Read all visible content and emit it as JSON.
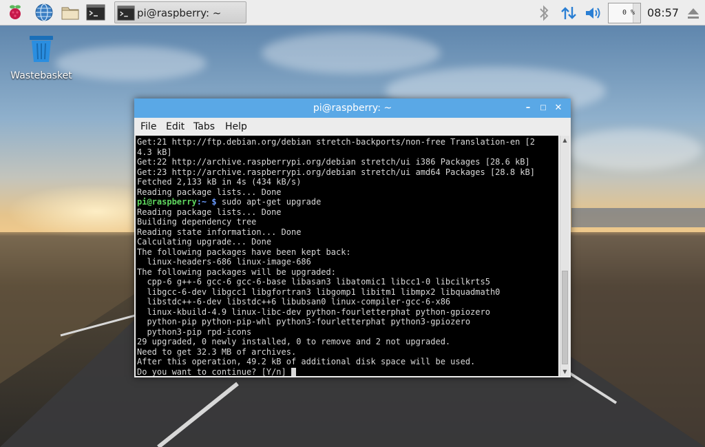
{
  "panel": {
    "icons": [
      "raspberry-menu-icon",
      "web-browser-icon",
      "file-manager-icon",
      "terminal-icon"
    ],
    "task": {
      "label": "pi@raspberry: ~"
    },
    "tray": [
      "bluetooth-icon",
      "network-transfer-icon",
      "volume-icon"
    ],
    "cpu_usage": "0 %",
    "clock": "08:57",
    "eject_icon": "eject-icon"
  },
  "desktop": {
    "icons": [
      {
        "label": "Wastebasket",
        "icon": "wastebasket-icon"
      }
    ]
  },
  "terminal": {
    "title": "pi@raspberry: ~",
    "menu": [
      "File",
      "Edit",
      "Tabs",
      "Help"
    ],
    "lines": [
      "Get:21 http://ftp.debian.org/debian stretch-backports/non-free Translation-en [2",
      "4.3 kB]",
      "Get:22 http://archive.raspberrypi.org/debian stretch/ui i386 Packages [28.6 kB]",
      "Get:23 http://archive.raspberrypi.org/debian stretch/ui amd64 Packages [28.8 kB]",
      "Fetched 2,133 kB in 4s (434 kB/s)",
      "Reading package lists... Done"
    ],
    "prompt": {
      "user": "pi@raspberry",
      "path": ":~ $",
      "command": " sudo apt-get upgrade"
    },
    "output": [
      "Reading package lists... Done",
      "Building dependency tree",
      "Reading state information... Done",
      "Calculating upgrade... Done",
      "The following packages have been kept back:",
      "  linux-headers-686 linux-image-686",
      "The following packages will be upgraded:",
      "  cpp-6 g++-6 gcc-6 gcc-6-base libasan3 libatomic1 libcc1-0 libcilkrts5",
      "  libgcc-6-dev libgcc1 libgfortran3 libgomp1 libitm1 libmpx2 libquadmath0",
      "  libstdc++-6-dev libstdc++6 libubsan0 linux-compiler-gcc-6-x86",
      "  linux-kbuild-4.9 linux-libc-dev python-fourletterphat python-gpiozero",
      "  python-pip python-pip-whl python3-fourletterphat python3-gpiozero",
      "  python3-pip rpd-icons",
      "29 upgraded, 0 newly installed, 0 to remove and 2 not upgraded.",
      "Need to get 32.3 MB of archives.",
      "After this operation, 49.2 kB of additional disk space will be used."
    ],
    "final_prompt": "Do you want to continue? [Y/n] "
  }
}
